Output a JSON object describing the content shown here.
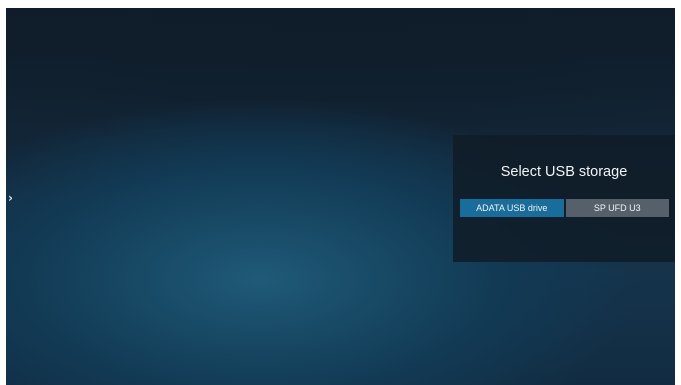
{
  "navigation": {
    "left_arrow": "›",
    "right_arrow": "‹",
    "left_arrow_icon": "chevron-right-icon",
    "right_arrow_icon": "chevron-left-icon"
  },
  "dialog": {
    "title": "Select USB storage",
    "options": [
      {
        "label": "ADATA USB drive",
        "selected": true
      },
      {
        "label": "SP UFD U3",
        "selected": false
      }
    ]
  },
  "colors": {
    "selected_button": "#1a6c9a",
    "normal_button": "#56606a",
    "dialog_background": "#101c28"
  }
}
